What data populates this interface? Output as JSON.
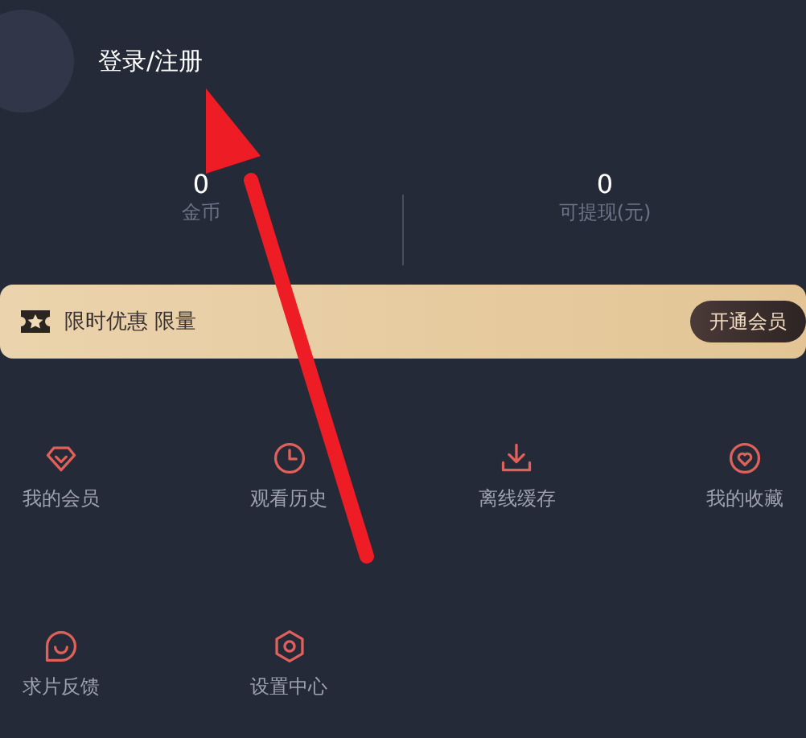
{
  "profile": {
    "login_label": "登录/注册"
  },
  "stats": [
    {
      "value": "0",
      "label": "金币"
    },
    {
      "value": "0",
      "label": "可提现(元)"
    }
  ],
  "promo": {
    "text": "限时优惠 限量",
    "button": "开通会员"
  },
  "menu": [
    {
      "kind": "diamond",
      "label": "我的会员"
    },
    {
      "kind": "clock",
      "label": "观看历史"
    },
    {
      "kind": "download",
      "label": "离线缓存"
    },
    {
      "kind": "heart",
      "label": "我的收藏"
    },
    {
      "kind": "chat",
      "label": "求片反馈"
    },
    {
      "kind": "hexagon",
      "label": "设置中心"
    }
  ]
}
